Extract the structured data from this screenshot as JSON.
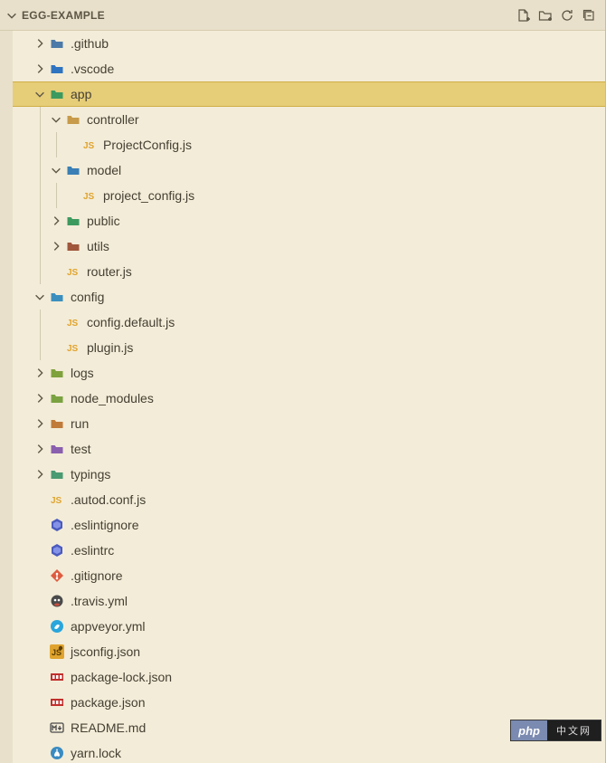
{
  "header": {
    "title": "EGG-EXAMPLE",
    "actions": [
      "new-file",
      "new-folder",
      "refresh",
      "collapse-all"
    ]
  },
  "badge": {
    "left": "php",
    "right": "中文网"
  },
  "tree": [
    {
      "depth": 1,
      "exp": "closed",
      "icon": "folder-github",
      "label": ".github"
    },
    {
      "depth": 1,
      "exp": "closed",
      "icon": "folder-vscode",
      "label": ".vscode"
    },
    {
      "depth": 1,
      "exp": "open",
      "icon": "folder-app",
      "label": "app",
      "selected": true
    },
    {
      "depth": 2,
      "exp": "open",
      "icon": "folder-ctrl",
      "label": "controller"
    },
    {
      "depth": 3,
      "exp": "none",
      "icon": "js",
      "label": "ProjectConfig.js"
    },
    {
      "depth": 2,
      "exp": "open",
      "icon": "folder-model",
      "label": "model"
    },
    {
      "depth": 3,
      "exp": "none",
      "icon": "js",
      "label": "project_config.js"
    },
    {
      "depth": 2,
      "exp": "closed",
      "icon": "folder-public",
      "label": "public"
    },
    {
      "depth": 2,
      "exp": "closed",
      "icon": "folder-utils",
      "label": "utils"
    },
    {
      "depth": 2,
      "exp": "none",
      "icon": "js",
      "label": "router.js"
    },
    {
      "depth": 1,
      "exp": "open",
      "icon": "folder-config",
      "label": "config"
    },
    {
      "depth": 2,
      "exp": "none",
      "icon": "js",
      "label": "config.default.js"
    },
    {
      "depth": 2,
      "exp": "none",
      "icon": "js",
      "label": "plugin.js"
    },
    {
      "depth": 1,
      "exp": "closed",
      "icon": "folder-logs",
      "label": "logs"
    },
    {
      "depth": 1,
      "exp": "closed",
      "icon": "folder-node",
      "label": "node_modules"
    },
    {
      "depth": 1,
      "exp": "closed",
      "icon": "folder-run",
      "label": "run"
    },
    {
      "depth": 1,
      "exp": "closed",
      "icon": "folder-test",
      "label": "test"
    },
    {
      "depth": 1,
      "exp": "closed",
      "icon": "folder-typings",
      "label": "typings"
    },
    {
      "depth": 1,
      "exp": "none",
      "icon": "js",
      "label": ".autod.conf.js"
    },
    {
      "depth": 1,
      "exp": "none",
      "icon": "eslint",
      "label": ".eslintignore"
    },
    {
      "depth": 1,
      "exp": "none",
      "icon": "eslint",
      "label": ".eslintrc"
    },
    {
      "depth": 1,
      "exp": "none",
      "icon": "git",
      "label": ".gitignore"
    },
    {
      "depth": 1,
      "exp": "none",
      "icon": "travis",
      "label": ".travis.yml"
    },
    {
      "depth": 1,
      "exp": "none",
      "icon": "appveyor",
      "label": "appveyor.yml"
    },
    {
      "depth": 1,
      "exp": "none",
      "icon": "jsconfig",
      "label": "jsconfig.json"
    },
    {
      "depth": 1,
      "exp": "none",
      "icon": "npm",
      "label": "package-lock.json"
    },
    {
      "depth": 1,
      "exp": "none",
      "icon": "npm",
      "label": "package.json"
    },
    {
      "depth": 1,
      "exp": "none",
      "icon": "md",
      "label": "README.md"
    },
    {
      "depth": 1,
      "exp": "none",
      "icon": "yarn",
      "label": "yarn.lock"
    }
  ]
}
